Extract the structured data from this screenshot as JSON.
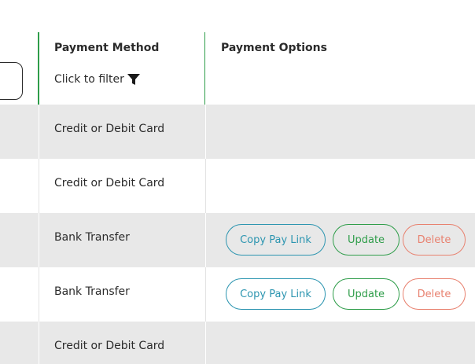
{
  "table": {
    "headers": {
      "method": "Payment Method",
      "options": "Payment Options",
      "filter_label": "Click to filter"
    },
    "rows": [
      {
        "method": "Credit or Debit Card",
        "actions": []
      },
      {
        "method": "Credit or Debit Card",
        "actions": []
      },
      {
        "method": "Bank Transfer",
        "actions": [
          "Copy Pay Link",
          "Update",
          "Delete"
        ]
      },
      {
        "method": "Bank Transfer",
        "actions": [
          "Copy Pay Link",
          "Update",
          "Delete"
        ]
      },
      {
        "method": "Credit or Debit Card",
        "actions": []
      }
    ]
  },
  "colors": {
    "accent_green": "#2f9d4a",
    "accent_teal": "#2c95b0",
    "accent_red": "#e8816f",
    "row_shade": "#e8e8e8"
  },
  "icons": {
    "filter": "funnel-icon"
  }
}
